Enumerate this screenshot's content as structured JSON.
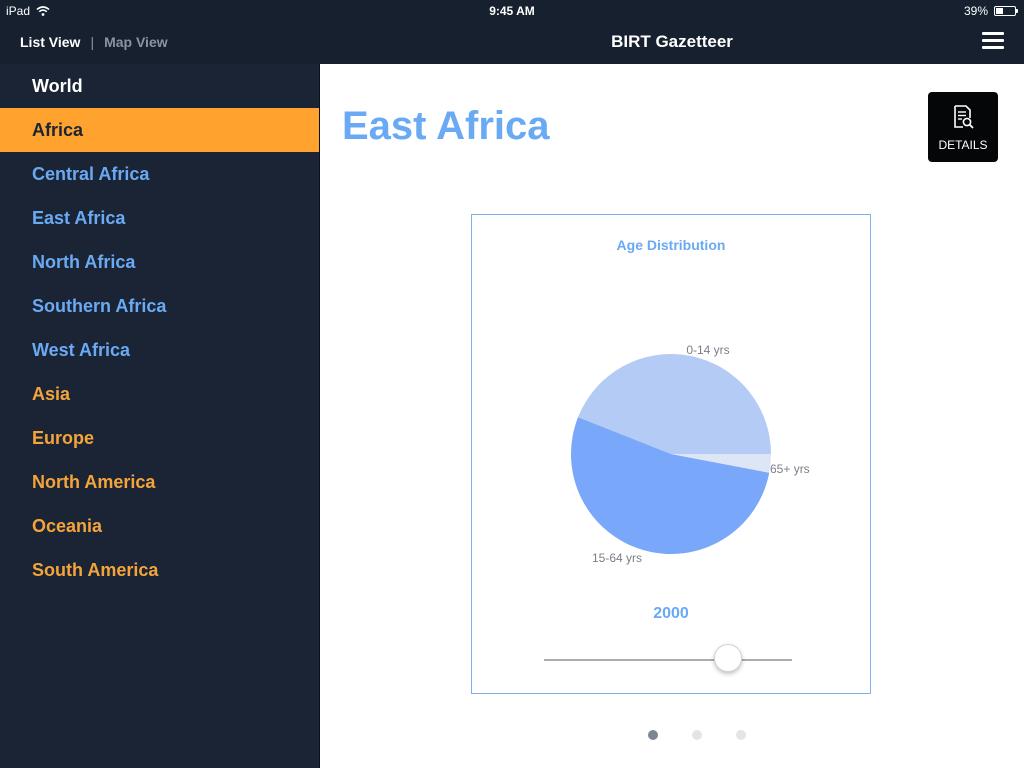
{
  "status_bar": {
    "device": "iPad",
    "time": "9:45 AM",
    "battery_text": "39%",
    "battery_level": 0.39
  },
  "nav": {
    "list_view": "List View",
    "separator": "|",
    "map_view": "Map View",
    "title": "BIRT Gazetteer"
  },
  "sidebar": {
    "items": [
      {
        "label": "World",
        "style": "world"
      },
      {
        "label": "Africa",
        "style": "selected"
      },
      {
        "label": "Central Africa",
        "style": "blue"
      },
      {
        "label": "East Africa",
        "style": "blue"
      },
      {
        "label": "North Africa",
        "style": "blue"
      },
      {
        "label": "Southern Africa",
        "style": "blue"
      },
      {
        "label": "West Africa",
        "style": "blue"
      },
      {
        "label": "Asia",
        "style": "orange"
      },
      {
        "label": "Europe",
        "style": "orange"
      },
      {
        "label": "North America",
        "style": "orange"
      },
      {
        "label": "Oceania",
        "style": "orange"
      },
      {
        "label": "South America",
        "style": "orange"
      }
    ]
  },
  "main": {
    "title": "East Africa",
    "details_label": "DETAILS",
    "year": "2000",
    "slider_value": 0.74,
    "page_count": 3,
    "active_page": 0
  },
  "colors": {
    "accent_blue": "#6aa9f4",
    "accent_orange": "#ffa32e",
    "sidebar_bg": "#1a2434",
    "pie_0_14": "#b4cbf6",
    "pie_15_64": "#79a7fa",
    "pie_65": "#dde6f7"
  },
  "chart_data": {
    "type": "pie",
    "title": "Age Distribution",
    "categories": [
      "0-14 yrs",
      "15-64 yrs",
      "65+ yrs"
    ],
    "values": [
      44,
      53,
      3
    ]
  }
}
